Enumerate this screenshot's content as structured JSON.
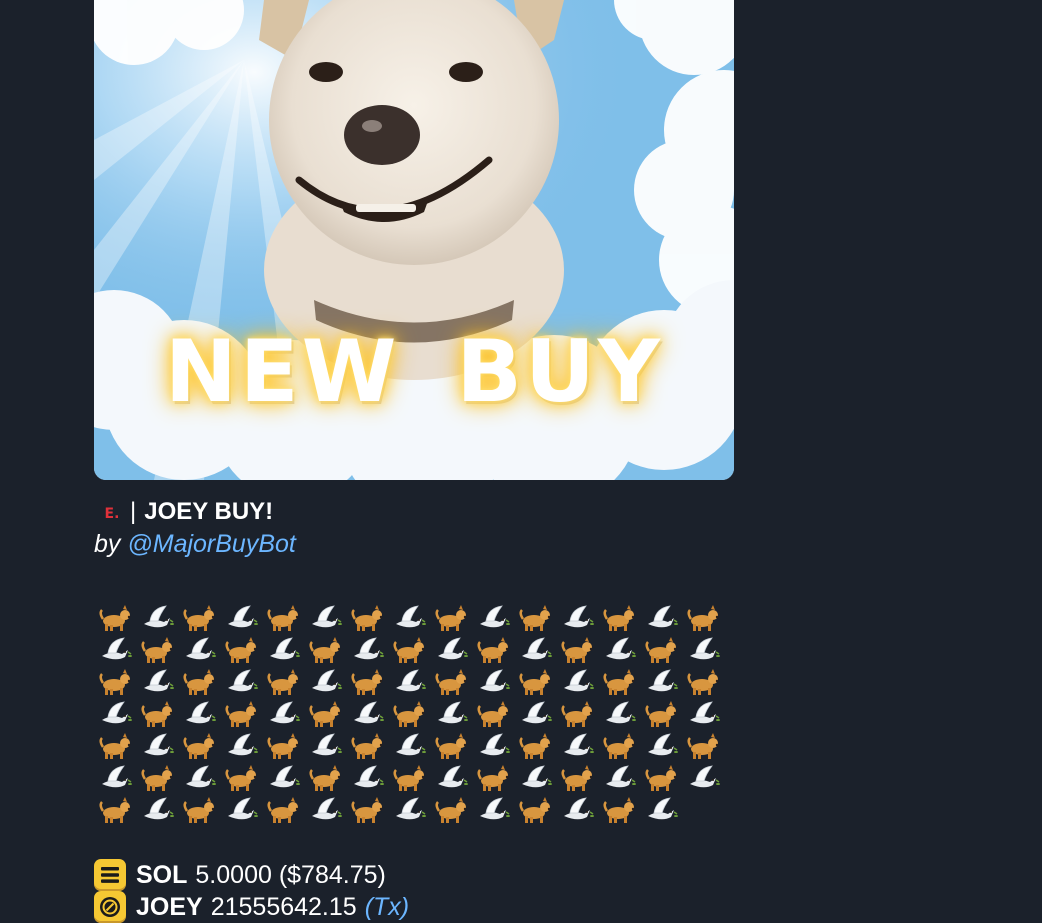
{
  "media": {
    "caption": "NEW BUY"
  },
  "post": {
    "brand_mark": "E.",
    "separator": "|",
    "title": "JOEY BUY!",
    "by_prefix": "by",
    "bot_handle": "@MajorBuyBot"
  },
  "emoji_grid": {
    "rows": 7,
    "columns": 15,
    "last_row_count": 14
  },
  "stats": [
    {
      "icon": "solana-icon",
      "label": "SOL",
      "value": "5.0000 ($784.75)",
      "link": ""
    },
    {
      "icon": "joey-token-icon",
      "label": "JOEY",
      "value": "21555642.15",
      "link": "(Tx)"
    }
  ],
  "colors": {
    "background": "#1b212b",
    "link": "#6cb6ff",
    "brand_mark": "#e0313a",
    "token_yellow": "#f6c833"
  }
}
